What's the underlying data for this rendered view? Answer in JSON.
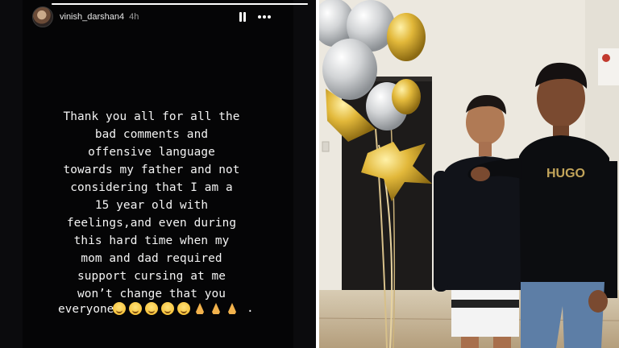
{
  "story": {
    "username": "vinish_darshan4",
    "time_ago": "4h",
    "progress": 1.0,
    "message": "Thank you all for all the\nbad comments and\noffensive language\ntowards my father and not\nconsidering that I am a\n15 year old with\nfeelings,and even during\nthis hard time when my\nmom and dad required\nsupport cursing at me\nwon’t change that you",
    "closing_word": "everyone",
    "closing_punct": ".",
    "icons": {
      "avatar": "profile-avatar",
      "pause": "pause-icon",
      "more": "more-options-icon",
      "emojis": [
        "smiling-face",
        "smiling-face",
        "smiling-face",
        "smiling-face",
        "smiling-face",
        "folded-hands",
        "folded-hands",
        "folded-hands"
      ]
    },
    "colors": {
      "background": "#050506",
      "text": "#f4f4f4"
    }
  },
  "photo": {
    "description_icon": "photo-balloons-two-people",
    "shirt_text": "HUGO",
    "colors": {
      "balloon_gold": "#e2b83a",
      "balloon_silver": "#d2d4d6",
      "wall": "#eae6dc"
    }
  }
}
